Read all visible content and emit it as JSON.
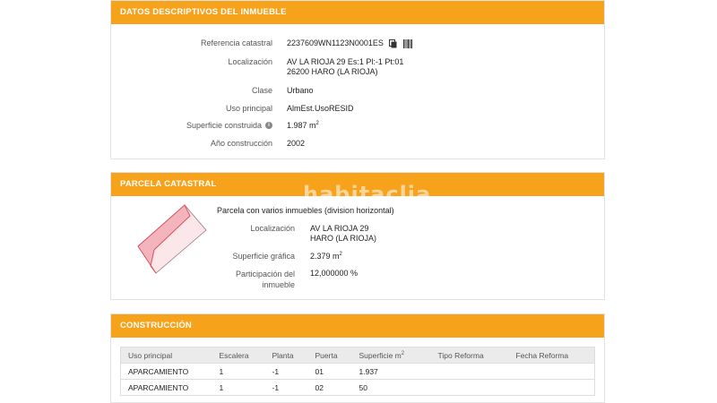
{
  "datos": {
    "title": "DATOS DESCRIPTIVOS DEL INMUEBLE",
    "ref_label": "Referencia catastral",
    "ref_value": "2237609WN1123N0001ES",
    "loc_label": "Localización",
    "loc_line1": "AV LA RIOJA 29 Es:1 Pl:-1 Pt:01",
    "loc_line2": "26200 HARO (LA RIOJA)",
    "clase_label": "Clase",
    "clase_value": "Urbano",
    "uso_label": "Uso principal",
    "uso_value": "AlmEst.UsoRESID",
    "sup_label": "Superficie construida",
    "sup_value": "1.987 m",
    "sup_unit_sup": "2",
    "anio_label": "Año construcción",
    "anio_value": "2002"
  },
  "parcela": {
    "title": "PARCELA CATASTRAL",
    "desc": "Parcela con varios inmuebles (division horizontal)",
    "loc_label": "Localización",
    "loc_line1": "AV LA RIOJA 29",
    "loc_line2": "HARO (LA RIOJA)",
    "sup_label": "Superficie gráfica",
    "sup_value": "2.379 m",
    "sup_unit_sup": "2",
    "part_label_1": "Participación del",
    "part_label_2": "inmueble",
    "part_value": "12,000000 %"
  },
  "construccion": {
    "title": "CONSTRUCCIÓN",
    "headers": [
      "Uso principal",
      "Escalera",
      "Planta",
      "Puerta",
      "Superficie m",
      "Tipo Reforma",
      "Fecha Reforma"
    ],
    "header_sup": "2",
    "rows": [
      [
        "APARCAMIENTO",
        "1",
        "-1",
        "01",
        "1.937",
        "",
        ""
      ],
      [
        "APARCAMIENTO",
        "1",
        "-1",
        "02",
        "50",
        "",
        ""
      ]
    ]
  },
  "watermark": "habitaclia",
  "colors": {
    "accent": "#f7a21b",
    "parcel_fill": "#f7c6cc",
    "parcel_stroke": "#d9535e"
  }
}
